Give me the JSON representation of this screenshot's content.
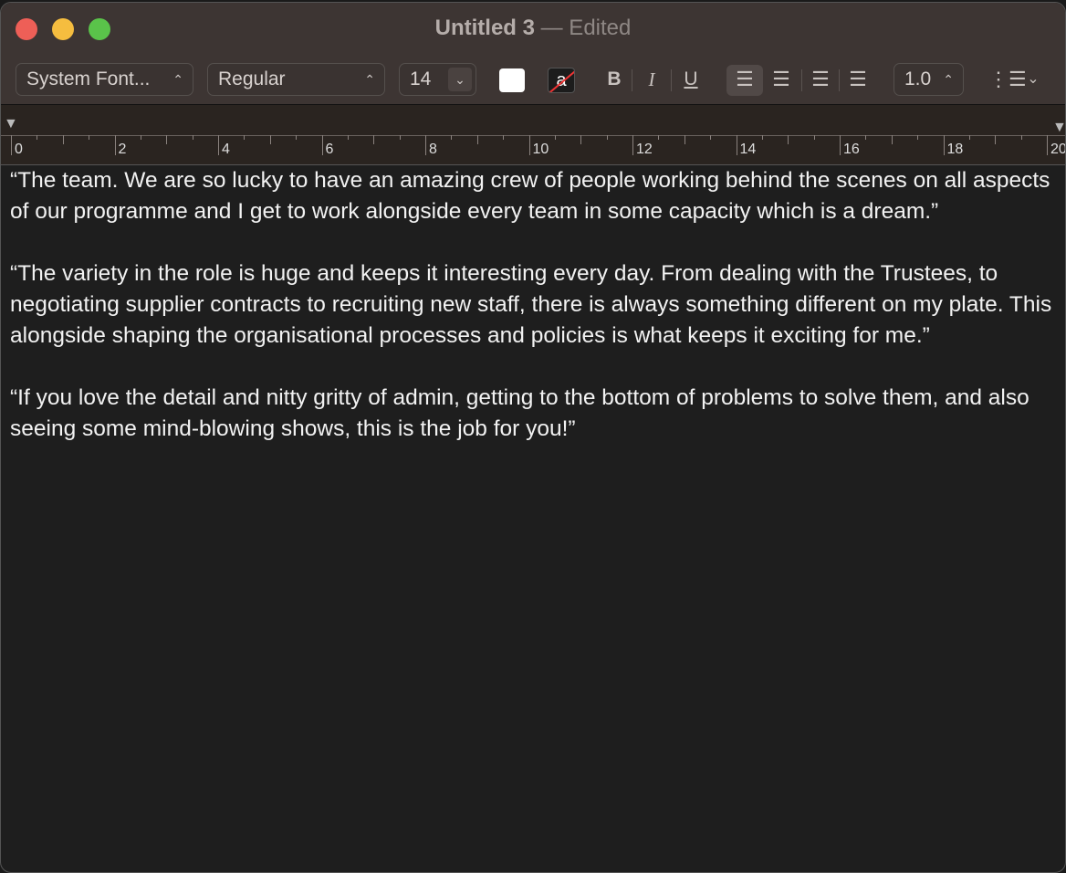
{
  "window": {
    "title": "Untitled 3",
    "edited": "— Edited"
  },
  "toolbar": {
    "font_family": "System Font...",
    "font_style": "Regular",
    "font_size": "14",
    "bold": "B",
    "italic": "I",
    "underline": "U",
    "line_spacing": "1.0",
    "text_color": "#ffffff",
    "highlight_label": "a"
  },
  "ruler": {
    "labels": [
      "0",
      "2",
      "4",
      "6",
      "8",
      "10",
      "12",
      "14",
      "16",
      "18",
      "20"
    ]
  },
  "document": {
    "paragraphs": [
      "“The team. We are so lucky to have an amazing crew of people working behind the scenes on all aspects of our programme and I get to work alongside every team in some capacity which is a dream.”",
      "“The variety in the role is huge and keeps it interesting every day. From dealing with the Trustees, to negotiating supplier contracts to recruiting new staff, there is always something different on my plate. This alongside shaping the organisational processes and policies is what keeps it exciting for me.”",
      "“If you love the detail and nitty gritty of admin, getting to the bottom of problems to solve them, and also seeing some mind-blowing shows, this is the job for you!”"
    ]
  }
}
